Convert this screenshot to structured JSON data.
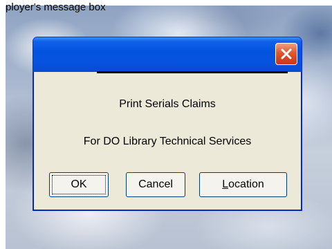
{
  "background": {
    "top_text": "ployer's message box"
  },
  "dialog": {
    "line1": "Print Serials Claims",
    "line2": "For DO Library Technical Services",
    "buttons": {
      "ok": "OK",
      "cancel": "Cancel",
      "location_first": "L",
      "location_rest": "ocation"
    }
  },
  "colors": {
    "title_blue": "#0653e0",
    "close_red": "#e0562e",
    "dialog_bg": "#ece9d8"
  }
}
